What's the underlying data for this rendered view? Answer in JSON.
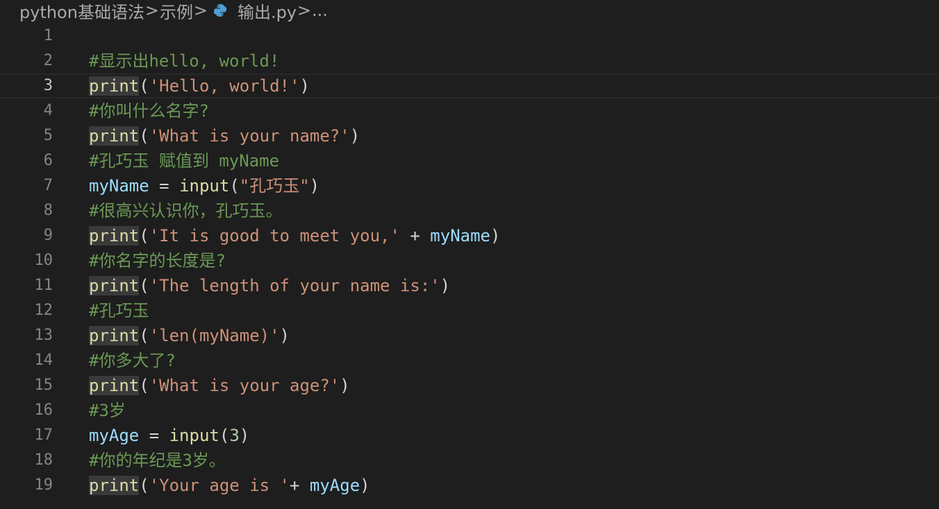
{
  "breadcrumb": {
    "items": [
      {
        "label": "python基础语法"
      },
      {
        "label": "示例"
      },
      {
        "label": "输出.py",
        "icon": "python-file-icon"
      },
      {
        "label": "..."
      }
    ],
    "separator": ">"
  },
  "colors": {
    "background": "#1e1e1e",
    "comment": "#6a9955",
    "function": "#dcdcaa",
    "string": "#ce9178",
    "variable": "#9cdcfe",
    "number": "#b5cea8",
    "line_number": "#858585"
  },
  "editor": {
    "current_line": 3,
    "lines": [
      {
        "n": "1",
        "tokens": []
      },
      {
        "n": "2",
        "tokens": [
          {
            "t": "comment",
            "v": "#显示出hello, world!"
          }
        ]
      },
      {
        "n": "3",
        "tokens": [
          {
            "t": "func",
            "v": "print"
          },
          {
            "t": "punc",
            "v": "("
          },
          {
            "t": "string",
            "v": "'Hello, world!'"
          },
          {
            "t": "punc",
            "v": ")"
          }
        ]
      },
      {
        "n": "4",
        "tokens": [
          {
            "t": "comment",
            "v": "#你叫什么名字?"
          }
        ]
      },
      {
        "n": "5",
        "tokens": [
          {
            "t": "func",
            "v": "print"
          },
          {
            "t": "punc",
            "v": "("
          },
          {
            "t": "string",
            "v": "'What is your name?'"
          },
          {
            "t": "punc",
            "v": ")"
          }
        ]
      },
      {
        "n": "6",
        "tokens": [
          {
            "t": "comment",
            "v": "#孔巧玉 赋值到 myName"
          }
        ]
      },
      {
        "n": "7",
        "tokens": [
          {
            "t": "var",
            "v": "myName"
          },
          {
            "t": "op",
            "v": " = "
          },
          {
            "t": "func",
            "v": "input"
          },
          {
            "t": "punc",
            "v": "("
          },
          {
            "t": "string",
            "v": "\"孔巧玉\""
          },
          {
            "t": "punc",
            "v": ")"
          }
        ]
      },
      {
        "n": "8",
        "tokens": [
          {
            "t": "comment",
            "v": "#很高兴认识你，孔巧玉。"
          }
        ]
      },
      {
        "n": "9",
        "tokens": [
          {
            "t": "func",
            "v": "print"
          },
          {
            "t": "punc",
            "v": "("
          },
          {
            "t": "string",
            "v": "'It is good to meet you,'"
          },
          {
            "t": "op",
            "v": " + "
          },
          {
            "t": "var",
            "v": "myName"
          },
          {
            "t": "punc",
            "v": ")"
          }
        ]
      },
      {
        "n": "10",
        "tokens": [
          {
            "t": "comment",
            "v": "#你名字的长度是?"
          }
        ]
      },
      {
        "n": "11",
        "tokens": [
          {
            "t": "func",
            "v": "print"
          },
          {
            "t": "punc",
            "v": "("
          },
          {
            "t": "string",
            "v": "'The length of your name is:'"
          },
          {
            "t": "punc",
            "v": ")"
          }
        ]
      },
      {
        "n": "12",
        "tokens": [
          {
            "t": "comment",
            "v": "#孔巧玉"
          }
        ]
      },
      {
        "n": "13",
        "tokens": [
          {
            "t": "func",
            "v": "print"
          },
          {
            "t": "punc",
            "v": "("
          },
          {
            "t": "string",
            "v": "'len(myName)'"
          },
          {
            "t": "punc",
            "v": ")"
          }
        ]
      },
      {
        "n": "14",
        "tokens": [
          {
            "t": "comment",
            "v": "#你多大了?"
          }
        ]
      },
      {
        "n": "15",
        "tokens": [
          {
            "t": "func",
            "v": "print"
          },
          {
            "t": "punc",
            "v": "("
          },
          {
            "t": "string",
            "v": "'What is your age?'"
          },
          {
            "t": "punc",
            "v": ")"
          }
        ]
      },
      {
        "n": "16",
        "tokens": [
          {
            "t": "comment",
            "v": "#3岁"
          }
        ]
      },
      {
        "n": "17",
        "tokens": [
          {
            "t": "var",
            "v": "myAge"
          },
          {
            "t": "op",
            "v": " = "
          },
          {
            "t": "func",
            "v": "input"
          },
          {
            "t": "punc",
            "v": "("
          },
          {
            "t": "number",
            "v": "3"
          },
          {
            "t": "punc",
            "v": ")"
          }
        ]
      },
      {
        "n": "18",
        "tokens": [
          {
            "t": "comment",
            "v": "#你的年纪是3岁。"
          }
        ]
      },
      {
        "n": "19",
        "tokens": [
          {
            "t": "func",
            "v": "print"
          },
          {
            "t": "punc",
            "v": "("
          },
          {
            "t": "string",
            "v": "'Your age is '"
          },
          {
            "t": "op",
            "v": "+ "
          },
          {
            "t": "var",
            "v": "myAge"
          },
          {
            "t": "punc",
            "v": ")"
          }
        ]
      }
    ]
  }
}
